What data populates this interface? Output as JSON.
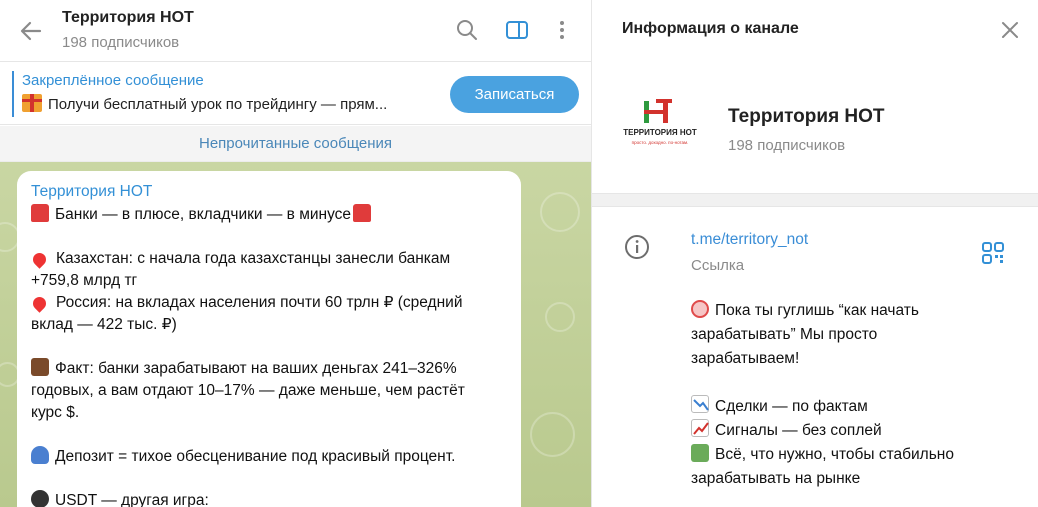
{
  "chat": {
    "title": "Территория НОТ",
    "subscribers": "198 подписчиков",
    "pinned_title": "Закреплённое сообщение",
    "pinned_text": "Получи бесплатный урок по трейдингу — прям...",
    "join_label": "Записаться",
    "unread_label": "Непрочитанные сообщения",
    "message": {
      "author": "Территория НОТ",
      "line1": "Банки — в плюсе, вкладчики — в минусе",
      "line2": "Казахстан: с начала года казахстанцы занесли банкам",
      "line3": "+759,8 млрд тг",
      "line4": "Россия: на вкладах населения почти 60 трлн ₽ (средний",
      "line5": "вклад — 422 тыс. ₽)",
      "line6": "Факт: банки зарабатывают на ваших деньгах 241–326%",
      "line7": "годовых, а вам отдают 10–17% — даже меньше, чем растёт",
      "line8": "курс $.",
      "line9": "Депозит = тихое обесценивание под красивый процент.",
      "line10": "USDT — другая игра:"
    }
  },
  "info": {
    "title": "Информация о канале",
    "name": "Территория НОТ",
    "subscribers": "198 подписчиков",
    "logo_text": "ТЕРРИТОРИЯ НОТ",
    "logo_tagline": "просто. доходно. по-нотам.",
    "link": "t.me/territory_not",
    "link_label": "Ссылка",
    "desc1": "Пока ты гуглишь “как начать",
    "desc2": "зарабатывать” Мы просто",
    "desc3": "зарабатываем!",
    "desc4": "Сделки — по фактам",
    "desc5": "Сигналы — без соплей",
    "desc6": "Всё, что нужно, чтобы стабильно",
    "desc7": "зарабатывать на рынке"
  },
  "icons": {
    "back": "arrow-left-icon",
    "search": "search-icon",
    "sidebar": "sidebar-toggle-icon",
    "more": "more-vertical-icon",
    "close": "close-icon",
    "info": "info-icon",
    "qr": "qr-code-icon"
  },
  "colors": {
    "accent": "#3390d6",
    "button": "#4aa2e0",
    "chat_bg": "#c2d19a"
  }
}
